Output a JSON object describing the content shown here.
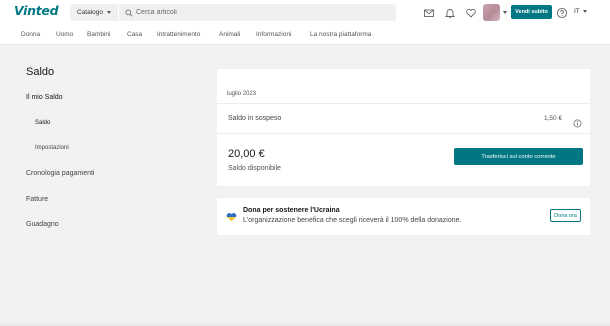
{
  "header": {
    "logo": "Vinted",
    "catalog_label": "Catalogo",
    "search_placeholder": "Cerca articoli",
    "sell_button": "Vendi subito",
    "language": "IT",
    "icons": [
      "mail-icon",
      "bell-icon",
      "heart-icon",
      "help-icon"
    ]
  },
  "nav": {
    "items": [
      "Donna",
      "Uomo",
      "Bambini",
      "Casa",
      "Intrattenimento",
      "Animali",
      "Informazioni",
      "La nostra piattaforma"
    ]
  },
  "sidebar": {
    "title": "Saldo",
    "items": [
      {
        "label": "Il mio Saldo"
      },
      {
        "label": "Saldo"
      },
      {
        "label": "Impostazioni"
      },
      {
        "label": "Cronologia pagamenti"
      },
      {
        "label": "Fatture"
      },
      {
        "label": "Guadagno"
      }
    ]
  },
  "balance": {
    "date": "luglio 2023",
    "pending_label": "Saldo in sospeso",
    "pending_amount": "1,50 €",
    "available_amount": "20,00 €",
    "available_label": "Saldo disponibile",
    "transfer_button": "Trasferisci sul conto corrente"
  },
  "donation": {
    "title": "Dona per sostenere l'Ucraina",
    "text": "L'organizzazione benefica che scegli riceverà il 100% della donazione.",
    "button": "Dona ora"
  },
  "colors": {
    "brand": "#007782",
    "background": "#f2f2f2"
  }
}
